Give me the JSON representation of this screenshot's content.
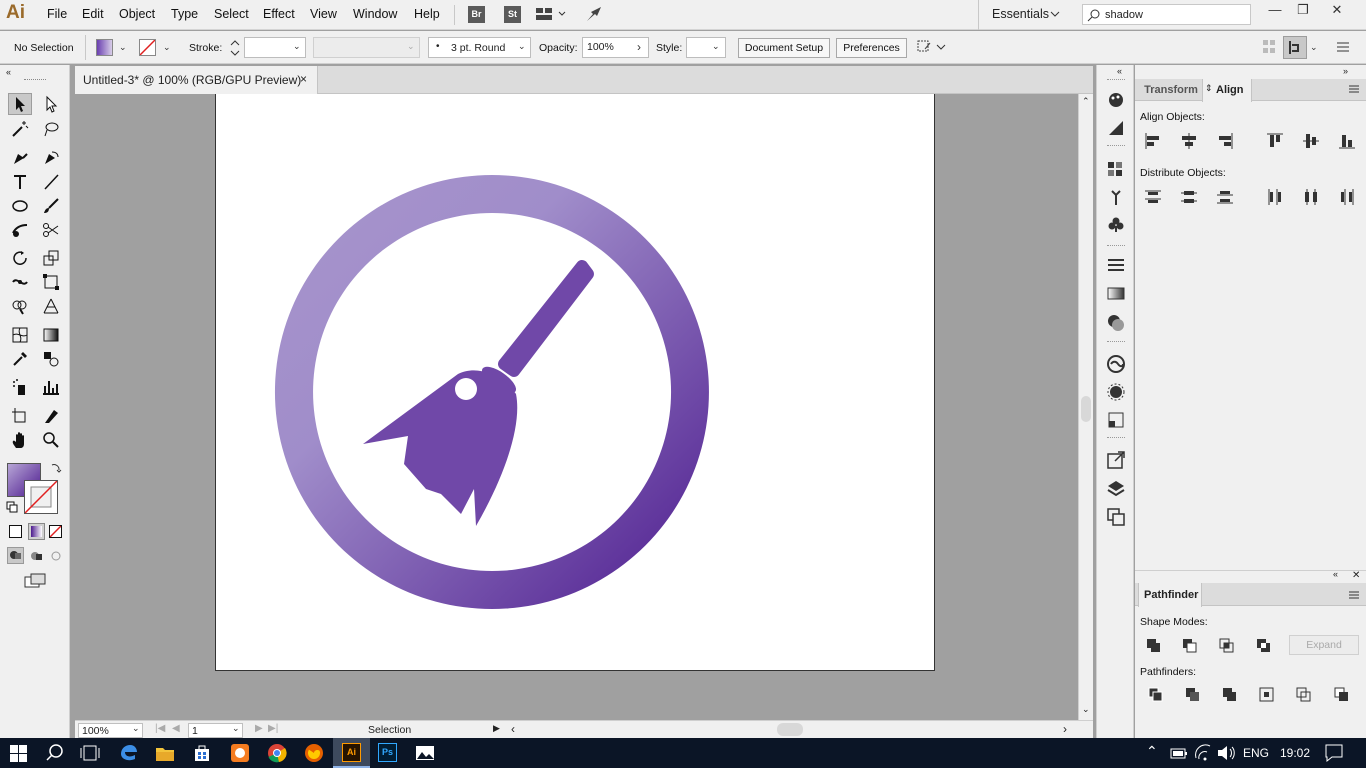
{
  "app": {
    "logo": "Ai",
    "accent": "#9a6a2a"
  },
  "menubar": {
    "items": [
      "File",
      "Edit",
      "Object",
      "Type",
      "Select",
      "Effect",
      "View",
      "Window",
      "Help"
    ],
    "bridge": "Br",
    "stock": "St",
    "workspace": "Essentials",
    "search_value": "shadow"
  },
  "controlbar": {
    "selection_status": "No Selection",
    "stroke_label": "Stroke:",
    "brush_value": "3 pt. Round",
    "opacity_label": "Opacity:",
    "opacity_value": "100%",
    "style_label": "Style:",
    "document_setup": "Document Setup",
    "preferences": "Preferences"
  },
  "document": {
    "tab_title": "Untitled-3* @ 100% (RGB/GPU Preview)",
    "close": "×"
  },
  "statusbar": {
    "zoom": "100%",
    "artboard_number": "1",
    "tool_status": "Selection"
  },
  "align_panel": {
    "tabs": [
      "Transform",
      "Align"
    ],
    "active_tab": "Align",
    "align_objects_label": "Align Objects:",
    "distribute_objects_label": "Distribute Objects:"
  },
  "pathfinder_panel": {
    "title": "Pathfinder",
    "shape_modes_label": "Shape Modes:",
    "expand_label": "Expand",
    "pathfinders_label": "Pathfinders:"
  },
  "artwork": {
    "gradient_light": "#a895cc",
    "gradient_dark": "#4c1a8e",
    "broom_color": "#7048a8"
  },
  "taskbar": {
    "language": "ENG",
    "time": "19:02"
  }
}
